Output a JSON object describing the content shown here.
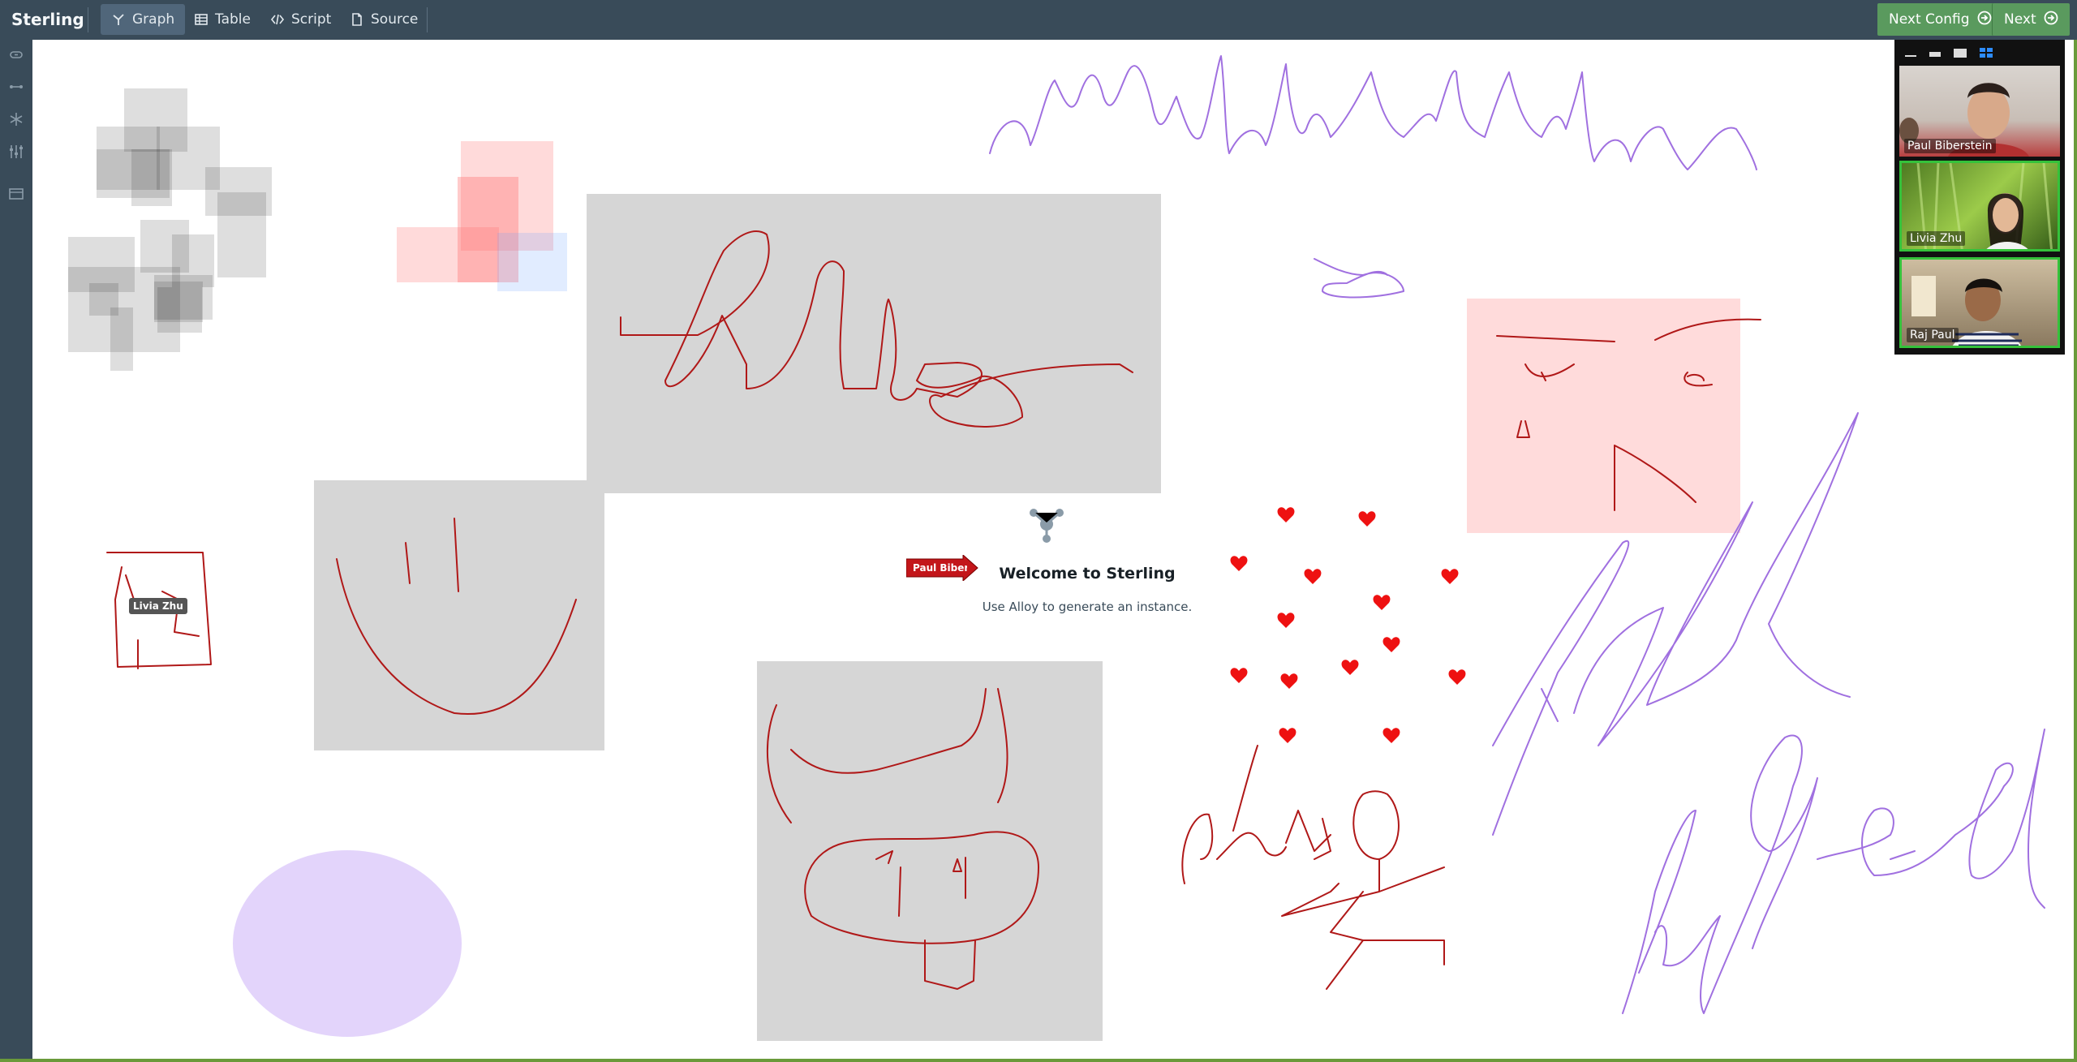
{
  "app": {
    "title": "Sterling"
  },
  "nav": {
    "tabs": [
      {
        "label": "Graph",
        "icon": "graph-icon",
        "active": true
      },
      {
        "label": "Table",
        "icon": "table-icon"
      },
      {
        "label": "Script",
        "icon": "code-icon"
      },
      {
        "label": "Source",
        "icon": "document-icon"
      }
    ]
  },
  "actions": {
    "next_config_label": "Next Config",
    "next_label": "Next"
  },
  "welcome": {
    "title": "Welcome to Sterling",
    "subtitle": "Use Alloy to generate an instance."
  },
  "cursors": {
    "paul": "Paul Biberstein",
    "livia": "Livia Zhu"
  },
  "video": {
    "participants": [
      {
        "name": "Paul Biberstein"
      },
      {
        "name": "Livia Zhu"
      },
      {
        "name": "Raj Paul"
      }
    ]
  },
  "colors": {
    "topbar": "#394b59",
    "accent_green": "#5a9a5e",
    "ink_red": "#b01818",
    "ink_purple": "#a070e0",
    "heart_red": "#ee1111"
  }
}
